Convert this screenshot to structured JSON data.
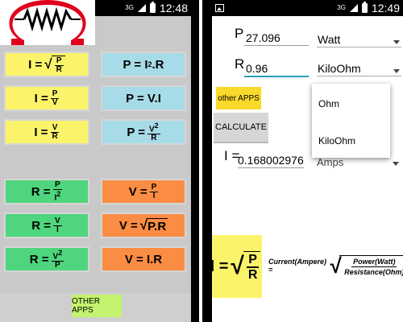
{
  "status": {
    "left_net": "3G",
    "left_time": "12:48",
    "right_net": "3G",
    "right_time": "12:49"
  },
  "left": {
    "buttons": [
      {
        "lhs": "I =",
        "type": "sqrt-frac",
        "num": "P",
        "den": "R"
      },
      {
        "lhs": "P = I",
        "sup": "2",
        "rest": ".R"
      },
      {
        "lhs": "I =",
        "type": "frac",
        "num": "P",
        "den": "V"
      },
      {
        "lhs": "P = V.I"
      },
      {
        "lhs": "I =",
        "type": "frac",
        "num": "V",
        "den": "R"
      },
      {
        "lhs": "P =",
        "type": "frac",
        "num": "V",
        "num_sup": "2",
        "den": "R"
      },
      {
        "lhs": "R =",
        "type": "frac",
        "num": "P",
        "den": "I",
        "den_sup": "2"
      },
      {
        "lhs": "V =",
        "type": "frac",
        "num": "P",
        "den": "I"
      },
      {
        "lhs": "R =",
        "type": "frac",
        "num": "V",
        "den": "I"
      },
      {
        "lhs": "V =",
        "type": "sqrt",
        "under": "P.R"
      },
      {
        "lhs": "R =",
        "type": "frac",
        "num": "V",
        "num_sup": "2",
        "den": "P"
      },
      {
        "lhs": "V = I.R"
      }
    ],
    "other_apps": "OTHER APPS"
  },
  "right": {
    "p_label": "P",
    "p_value": "27.096",
    "p_unit": "Watt",
    "r_label": "R",
    "r_value": "0.96",
    "r_unit": "KiloOhm",
    "other_apps": "other APPS",
    "calculate": "CALCULATE",
    "dropdown_options": [
      "Ohm",
      "KiloOhm"
    ],
    "i_label": "I =",
    "i_value": "0.168002976",
    "i_unit": "Amps",
    "formula": {
      "lhs": "I =",
      "num": "P",
      "den": "R",
      "text_lhs": "Current(Ampere) =",
      "text_num": "Power(Watt)",
      "text_den": "Resistance(Ohm)"
    }
  },
  "colors": {
    "yellow": "#fbf46a",
    "blue": "#a8dbe8",
    "green": "#4ed57d",
    "orange": "#fb8c44",
    "logo_red": "#e0001b",
    "accent": "#28a0b4"
  }
}
